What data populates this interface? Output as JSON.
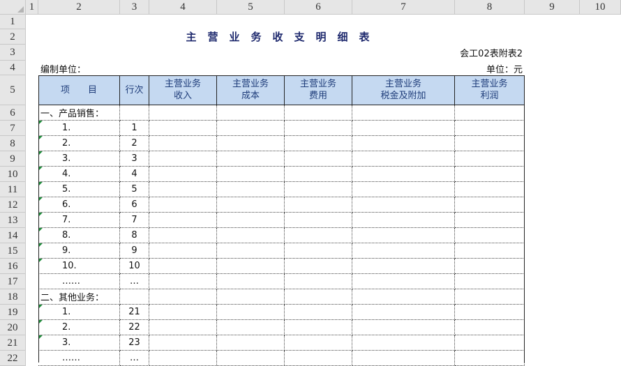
{
  "columns": [
    "",
    "1",
    "2",
    "3",
    "4",
    "5",
    "6",
    "7",
    "8",
    "9",
    "10"
  ],
  "row_numbers": [
    "1",
    "2",
    "3",
    "4",
    "5",
    "6",
    "7",
    "8",
    "9",
    "10",
    "11",
    "12",
    "13",
    "14",
    "15",
    "16",
    "17",
    "18",
    "19",
    "20",
    "21",
    "22"
  ],
  "title": "主营业务收支明细表",
  "form_no": "会工02表附表2",
  "unit_label": "编制单位：",
  "unit_value": "单位：元",
  "table": {
    "headers": [
      {
        "line1": "项　　目",
        "line2": ""
      },
      {
        "line1": "行次",
        "line2": ""
      },
      {
        "line1": "主营业务",
        "line2": "收入"
      },
      {
        "line1": "主营业务",
        "line2": "成本"
      },
      {
        "line1": "主营业务",
        "line2": "费用"
      },
      {
        "line1": "主营业务",
        "line2": "税金及附加"
      },
      {
        "line1": "主营业务",
        "line2": "利润"
      }
    ],
    "rows": [
      {
        "item": "一、产品销售：",
        "line": "",
        "indent": false,
        "flag": false
      },
      {
        "item": "1.",
        "line": "1",
        "indent": true,
        "flag": true
      },
      {
        "item": "2.",
        "line": "2",
        "indent": true,
        "flag": true
      },
      {
        "item": "3.",
        "line": "3",
        "indent": true,
        "flag": true
      },
      {
        "item": "4.",
        "line": "4",
        "indent": true,
        "flag": true
      },
      {
        "item": "5.",
        "line": "5",
        "indent": true,
        "flag": true
      },
      {
        "item": "6.",
        "line": "6",
        "indent": true,
        "flag": true
      },
      {
        "item": "7.",
        "line": "7",
        "indent": true,
        "flag": true
      },
      {
        "item": "8.",
        "line": "8",
        "indent": true,
        "flag": true
      },
      {
        "item": "9.",
        "line": "9",
        "indent": true,
        "flag": true
      },
      {
        "item": "10.",
        "line": "10",
        "indent": true,
        "flag": true
      },
      {
        "item": "……",
        "line": "…",
        "indent": true,
        "flag": false
      },
      {
        "item": "二、其他业务：",
        "line": "",
        "indent": false,
        "flag": false
      },
      {
        "item": "1.",
        "line": "21",
        "indent": true,
        "flag": true
      },
      {
        "item": "2.",
        "line": "22",
        "indent": true,
        "flag": true
      },
      {
        "item": "3.",
        "line": "23",
        "indent": true,
        "flag": true
      },
      {
        "item": "……",
        "line": "…",
        "indent": true,
        "flag": false
      }
    ]
  },
  "colors": {
    "header_fill": "#c5d9f1",
    "header_text": "#1f3d7a",
    "title_text": "#1f2a6e",
    "error_flag": "#1e8c3a"
  }
}
